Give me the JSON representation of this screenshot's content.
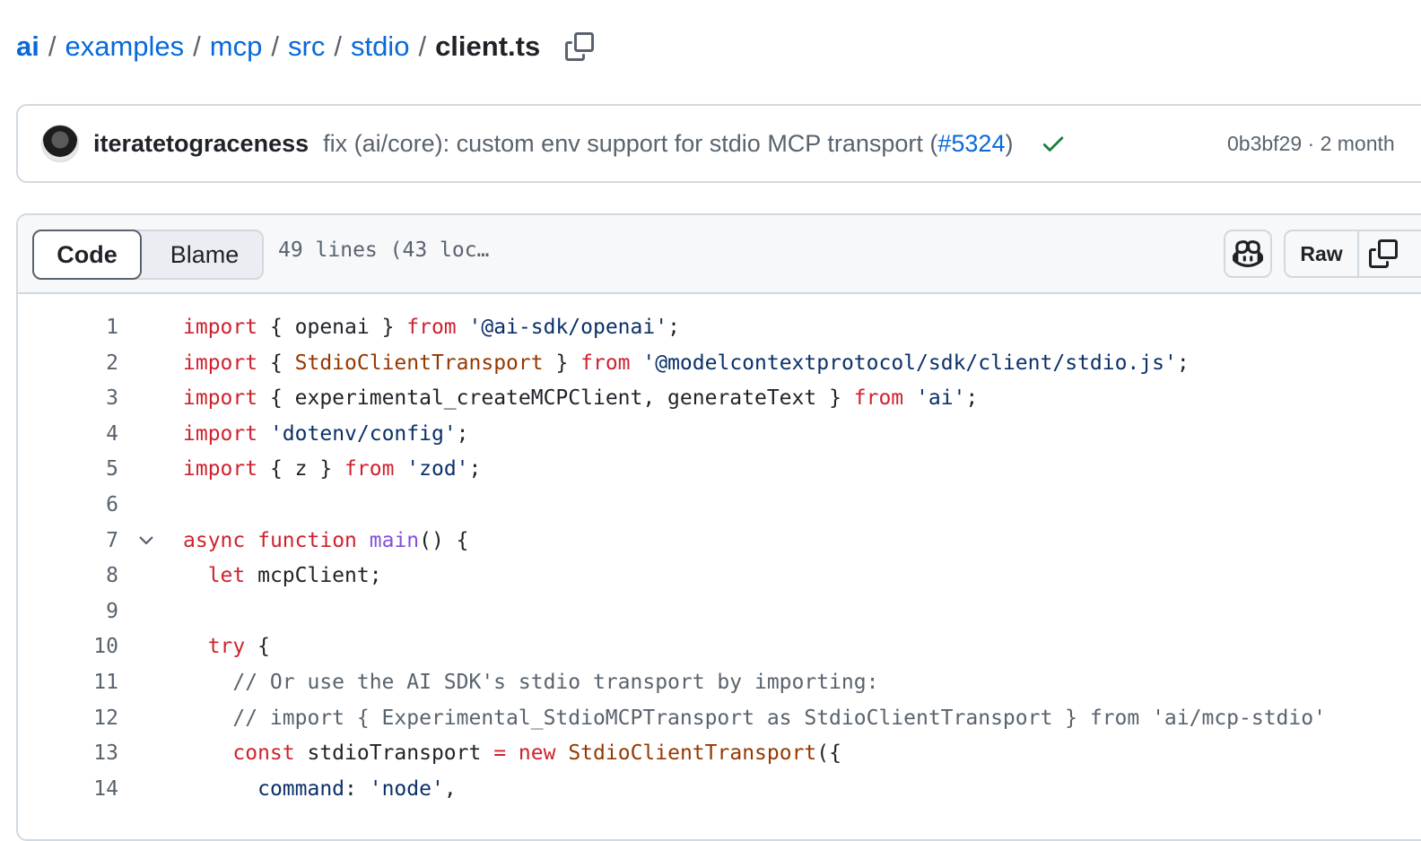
{
  "breadcrumb": {
    "items": [
      "ai",
      "examples",
      "mcp",
      "src",
      "stdio"
    ],
    "separator": "/",
    "file": "client.ts",
    "copy_icon": "copy-icon"
  },
  "commit": {
    "author": "iteratetograceness",
    "message_prefix": "fix (ai/core): custom env support for stdio MCP transport (",
    "pr_link": "#5324",
    "message_suffix": ")",
    "status_icon": "check-icon",
    "meta": "0b3bf29 · 2 month"
  },
  "file_header": {
    "tabs": [
      "Code",
      "Blame"
    ],
    "info": "49 lines (43 loc…",
    "copilot_icon": "copilot-icon",
    "raw_label": "Raw",
    "copy_icon": "copy-icon"
  },
  "code": {
    "lines": [
      {
        "n": "1",
        "fold": false,
        "tokens": [
          [
            "kw",
            "import"
          ],
          [
            "p",
            " { openai } "
          ],
          [
            "kw",
            "from"
          ],
          [
            "p",
            " "
          ],
          [
            "str",
            "'@ai-sdk/openai'"
          ],
          [
            "p",
            ";"
          ]
        ]
      },
      {
        "n": "2",
        "fold": false,
        "tokens": [
          [
            "kw",
            "import"
          ],
          [
            "p",
            " { "
          ],
          [
            "cls",
            "StdioClientTransport"
          ],
          [
            "p",
            " } "
          ],
          [
            "kw",
            "from"
          ],
          [
            "p",
            " "
          ],
          [
            "str",
            "'@modelcontextprotocol/sdk/client/stdio.js'"
          ],
          [
            "p",
            ";"
          ]
        ]
      },
      {
        "n": "3",
        "fold": false,
        "tokens": [
          [
            "kw",
            "import"
          ],
          [
            "p",
            " { experimental_createMCPClient, generateText } "
          ],
          [
            "kw",
            "from"
          ],
          [
            "p",
            " "
          ],
          [
            "str",
            "'ai'"
          ],
          [
            "p",
            ";"
          ]
        ]
      },
      {
        "n": "4",
        "fold": false,
        "tokens": [
          [
            "kw",
            "import"
          ],
          [
            "p",
            " "
          ],
          [
            "str",
            "'dotenv/config'"
          ],
          [
            "p",
            ";"
          ]
        ]
      },
      {
        "n": "5",
        "fold": false,
        "tokens": [
          [
            "kw",
            "import"
          ],
          [
            "p",
            " { z } "
          ],
          [
            "kw",
            "from"
          ],
          [
            "p",
            " "
          ],
          [
            "str",
            "'zod'"
          ],
          [
            "p",
            ";"
          ]
        ]
      },
      {
        "n": "6",
        "fold": false,
        "tokens": []
      },
      {
        "n": "7",
        "fold": true,
        "tokens": [
          [
            "kw",
            "async"
          ],
          [
            "p",
            " "
          ],
          [
            "kw",
            "function"
          ],
          [
            "p",
            " "
          ],
          [
            "fn",
            "main"
          ],
          [
            "p",
            "() {"
          ]
        ]
      },
      {
        "n": "8",
        "fold": false,
        "tokens": [
          [
            "p",
            "  "
          ],
          [
            "kw",
            "let"
          ],
          [
            "p",
            " mcpClient;"
          ]
        ]
      },
      {
        "n": "9",
        "fold": false,
        "tokens": []
      },
      {
        "n": "10",
        "fold": false,
        "tokens": [
          [
            "p",
            "  "
          ],
          [
            "kw",
            "try"
          ],
          [
            "p",
            " {"
          ]
        ]
      },
      {
        "n": "11",
        "fold": false,
        "tokens": [
          [
            "cm",
            "    // Or use the AI SDK's stdio transport by importing:"
          ]
        ]
      },
      {
        "n": "12",
        "fold": false,
        "tokens": [
          [
            "cm",
            "    // import { Experimental_StdioMCPTransport as StdioClientTransport } from 'ai/mcp-stdio'"
          ]
        ]
      },
      {
        "n": "13",
        "fold": false,
        "tokens": [
          [
            "p",
            "    "
          ],
          [
            "kw",
            "const"
          ],
          [
            "p",
            " stdioTransport "
          ],
          [
            "kw",
            "="
          ],
          [
            "p",
            " "
          ],
          [
            "kw",
            "new"
          ],
          [
            "p",
            " "
          ],
          [
            "cls",
            "StdioClientTransport"
          ],
          [
            "p",
            "({"
          ]
        ]
      },
      {
        "n": "14",
        "fold": false,
        "tokens": [
          [
            "p",
            "      "
          ],
          [
            "str",
            "command"
          ],
          [
            "p",
            ": "
          ],
          [
            "str",
            "'node'"
          ],
          [
            "p",
            ","
          ]
        ]
      }
    ]
  }
}
